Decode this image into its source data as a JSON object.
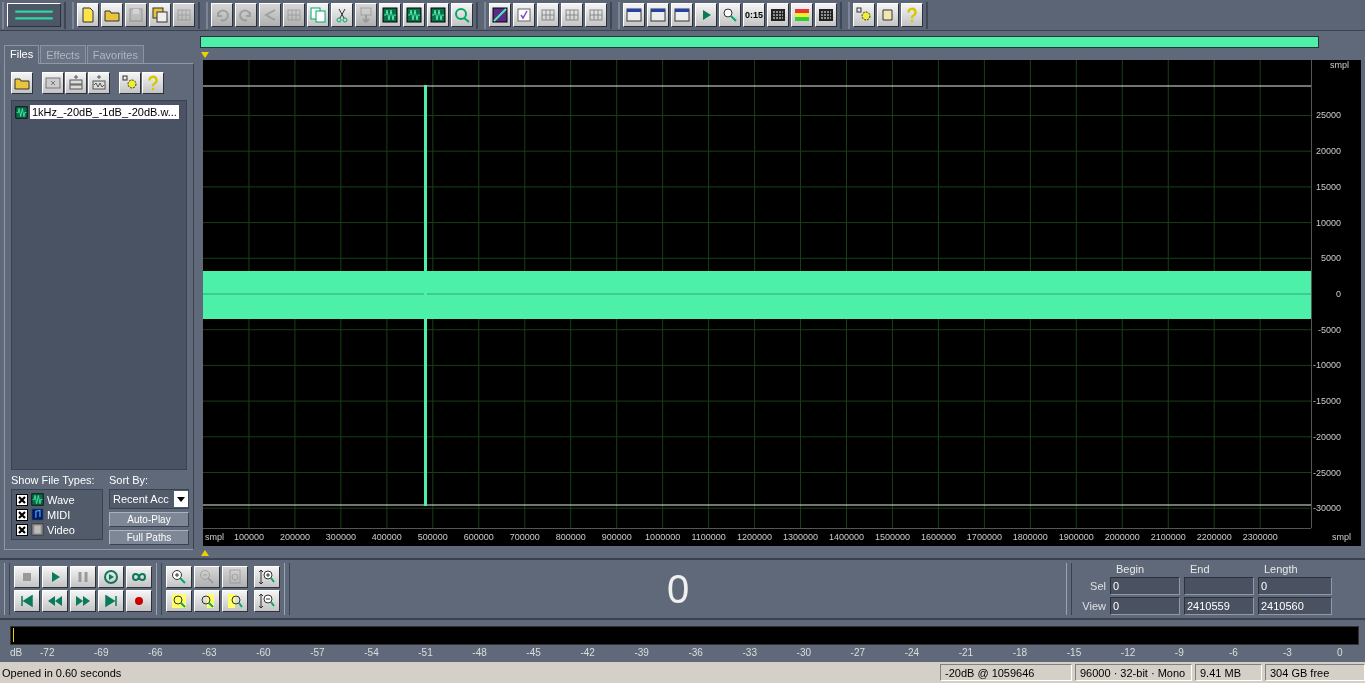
{
  "toolbar": [
    [
      {
        "disabled": false
      }
    ],
    [
      {
        "disabled": false
      },
      {
        "disabled": false
      },
      {
        "disabled": true
      },
      {
        "disabled": false
      },
      {
        "disabled": true
      }
    ],
    [
      {
        "disabled": true
      },
      {
        "disabled": true
      },
      {
        "disabled": true
      },
      {
        "disabled": true
      },
      {
        "disabled": false
      },
      {
        "disabled": false
      },
      {
        "disabled": true
      },
      {
        "disabled": false
      },
      {
        "disabled": false
      },
      {
        "disabled": false
      },
      {
        "disabled": false
      }
    ],
    [
      {
        "disabled": false
      },
      {
        "disabled": false
      },
      {
        "disabled": false
      },
      {
        "disabled": false
      },
      {
        "disabled": false
      }
    ],
    [
      {
        "disabled": false
      },
      {
        "disabled": false
      },
      {
        "disabled": false
      },
      {
        "disabled": false
      },
      {
        "disabled": false
      },
      {
        "disabled": false,
        "label": "0:15"
      },
      {
        "disabled": false
      },
      {
        "disabled": false
      },
      {
        "disabled": false
      }
    ],
    [
      {
        "disabled": false
      },
      {
        "disabled": false
      },
      {
        "disabled": false
      }
    ]
  ],
  "tabs": [
    {
      "label": "Files",
      "selected": true
    },
    {
      "label": "Effects",
      "selected": false
    },
    {
      "label": "Favorites",
      "selected": false
    }
  ],
  "file_list": [
    {
      "name": "1kHz_-20dB_-1dB_-20dB.w...",
      "selected": true
    }
  ],
  "show_file_types": {
    "label": "Show File Types:",
    "items": [
      {
        "label": "Wave",
        "checked": true
      },
      {
        "label": "MIDI",
        "checked": true
      },
      {
        "label": "Video",
        "checked": true
      }
    ]
  },
  "sort_by": {
    "label": "Sort By:",
    "value": "Recent Acc"
  },
  "panel_buttons": [
    "Auto-Play",
    "Full Paths"
  ],
  "waveform": {
    "y_unit": "smpl",
    "y_ticks": [
      "25000",
      "20000",
      "15000",
      "10000",
      "5000",
      "0",
      "-5000",
      "-10000",
      "-15000",
      "-20000",
      "-25000",
      "-30000"
    ],
    "x_unit": "smpl",
    "x_unit_right": "smpl",
    "x_ticks": [
      "100000",
      "200000",
      "300000",
      "400000",
      "500000",
      "600000",
      "700000",
      "800000",
      "900000",
      "1000000",
      "1100000",
      "1200000",
      "1300000",
      "1400000",
      "1500000",
      "1600000",
      "1700000",
      "1800000",
      "1900000",
      "2000000",
      "2100000",
      "2200000",
      "2300000"
    ]
  },
  "zoom_buttons": [
    {
      "disabled": false
    },
    {
      "disabled": true
    },
    {
      "disabled": true
    },
    {
      "disabled": false
    },
    {
      "disabled": false
    },
    {
      "disabled": false
    },
    {
      "disabled": false
    },
    {
      "disabled": false
    }
  ],
  "time_display": "0",
  "selection": {
    "columns": [
      "Begin",
      "End",
      "Length"
    ],
    "rows": [
      {
        "label": "Sel",
        "begin": "0",
        "length": "0"
      },
      {
        "label": "View",
        "begin": "0",
        "end": "2410559",
        "length": "2410560"
      }
    ]
  },
  "meter_scale": [
    "dB",
    "-72",
    "-69",
    "-66",
    "-63",
    "-60",
    "-57",
    "-54",
    "-51",
    "-48",
    "-45",
    "-42",
    "-39",
    "-36",
    "-33",
    "-30",
    "-27",
    "-24",
    "-21",
    "-18",
    "-15",
    "-12",
    "-9",
    "-6",
    "-3",
    "0"
  ],
  "status_bar": {
    "message": "Opened in 0.60 seconds",
    "cells": [
      "-20dB @ 1059646",
      "96000 · 32-bit · Mono",
      "9.41 MB",
      "304 GB free"
    ]
  }
}
